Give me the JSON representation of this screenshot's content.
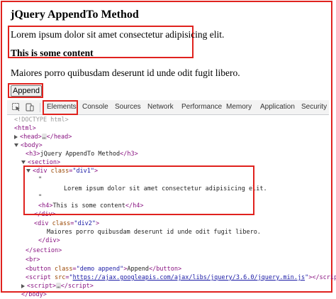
{
  "page": {
    "heading": "jQuery AppendTo Method",
    "div1_paragraph": "Lorem ipsum dolor sit amet consectetur adipisicing elit.",
    "div1_h4": "This is some content",
    "div2_paragraph": "Maiores porro quibusdam deserunt id unde odit fugit libero.",
    "append_button": "Append"
  },
  "devtools": {
    "tabs": [
      "Elements",
      "Console",
      "Sources",
      "Network",
      "Performance",
      "Memory",
      "Application",
      "Security"
    ],
    "active_tab": "Elements",
    "icons": [
      "inspect-element-icon",
      "device-toolbar-icon"
    ]
  },
  "dom": {
    "doctype": "<!DOCTYPE html>",
    "html_open": "html",
    "head": "head",
    "body": "body",
    "h3_tag": "h3",
    "h3_text": "jQuery AppendTo Method",
    "section": "section",
    "div1_class": "div1",
    "quote": "\"",
    "div1_text": "Lorem ipsum dolor sit amet consectetur adipisicing elit.",
    "h4_tag": "h4",
    "h4_text": "This is some content",
    "div2_class": "div2",
    "div2_text": "Maiores porro quibusdam deserunt id unde odit fugit libero.",
    "br": "br",
    "button_class": "demo append",
    "button_text": "Append",
    "script_src": "https://ajax.googleapis.com/ajax/libs/jquery/3.6.0/jquery.min.js",
    "ellipsis": "…"
  },
  "colors": {
    "highlight": "#e0221e",
    "tag": "#881280",
    "attr": "#994500",
    "value": "#1a1aa6"
  }
}
